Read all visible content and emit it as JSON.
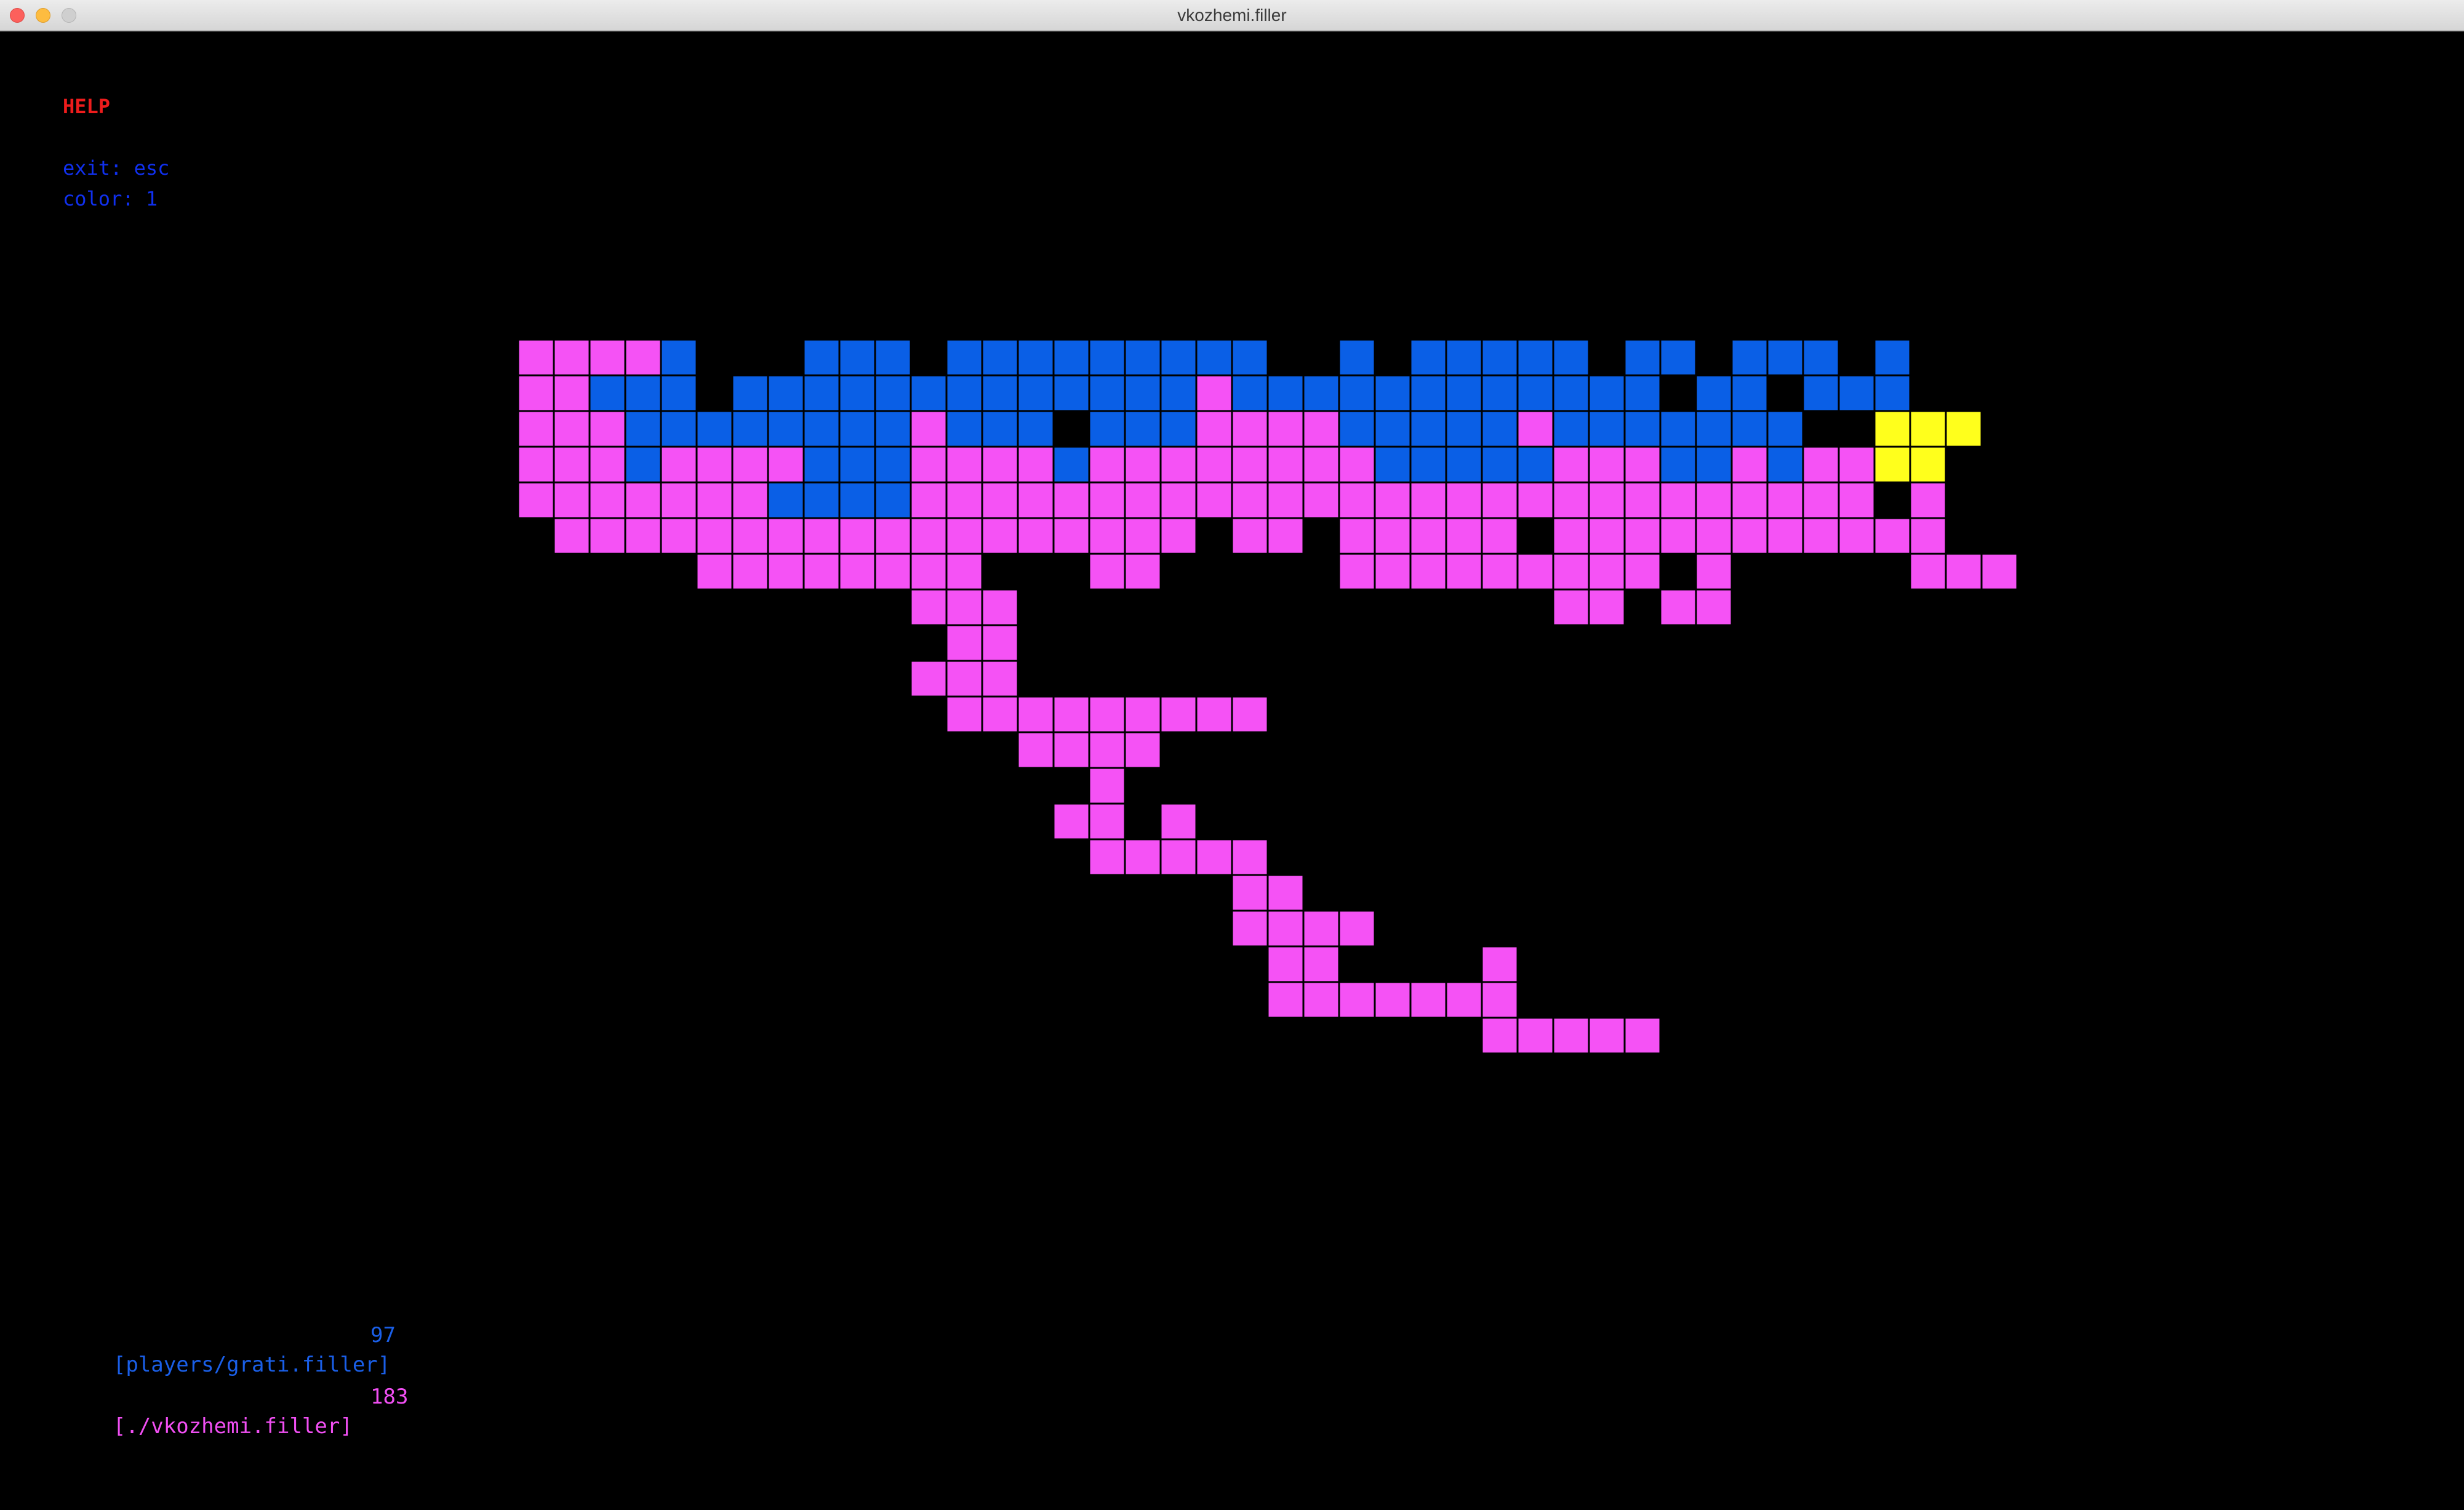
{
  "window": {
    "title": "vkozhemi.filler"
  },
  "help": {
    "title": "HELP",
    "lines": [
      "exit: esc",
      "color: 1"
    ]
  },
  "colors": {
    "background": "#000000",
    "player1": "#0a5fe6",
    "player2": "#f552f5",
    "piece": "#ffff1c",
    "grid_line": "#000000"
  },
  "board": {
    "legend": {
      "X": "player1",
      "O": "player2",
      "Y": "piece",
      ".": "empty"
    },
    "rows": [
      "OOOOX...XXX.XXXXXXXXX..X.XXXXX.XX.XXX.X..",
      "OOXXX.XXXXXXXXXXXXXOXXXXXXXXXXXX.XX.XXX..",
      "OOOXXXXXXXXOXXX.XXXOOOOXXXXXOXXXXXXX..YYY",
      "OOOXOOOOXXXOOOOXOOOOOOOOXXXXXOOOXXOXOOYY.",
      "OOOOOOOXXXXOOOOOOOOOOOOOOOOOOOOOOOOOOO.O.",
      ".OOOOOOOOOOOOOOOOOO.OO.OOOOO.OOOOOOOOOOO.",
      ".....OOOOOOOO...OO.....OOOOOOOOO.O.....OOO.",
      "...........OOO...............OO.OO........",
      "............OO...........................",
      "...........OOO...........................",
      "............OOOOOOOOO....................",
      "..............OOOO.......................",
      "................O........................",
      "...............OO.O......................",
      "................OOOOO....................",
      "....................OO...................",
      "....................OOOO.................",
      ".....................OO....O.............",
      ".....................OOOOOOO.............",
      "...........................OOOOO.........",
      "........................................."
    ]
  },
  "players": [
    {
      "name": "[players/grati.filler]",
      "score": "97",
      "color": "#1a5fe8"
    },
    {
      "name": "[./vkozhemi.filler]",
      "score": "183",
      "color": "#f14ff3"
    }
  ]
}
